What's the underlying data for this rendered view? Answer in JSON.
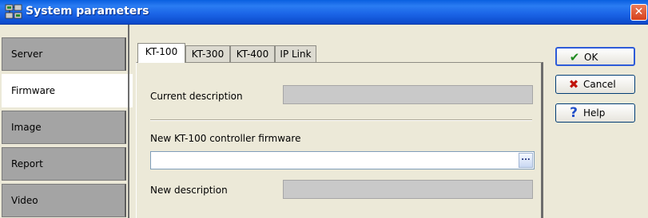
{
  "window": {
    "title": "System parameters",
    "close_symbol": "✕"
  },
  "nav": {
    "items": [
      {
        "label": "Server"
      },
      {
        "label": "Firmware"
      },
      {
        "label": "Image"
      },
      {
        "label": "Report"
      },
      {
        "label": "Video"
      }
    ],
    "active": "Firmware"
  },
  "tabs": {
    "items": [
      {
        "label": "KT-100"
      },
      {
        "label": "KT-300"
      },
      {
        "label": "KT-400"
      },
      {
        "label": "IP Link"
      }
    ],
    "active": "KT-100"
  },
  "firmware": {
    "current_description_label": "Current description",
    "current_description_value": "",
    "new_firmware_label": "New KT-100 controller firmware",
    "new_firmware_value": "",
    "browse_label": "...",
    "new_description_label": "New description",
    "new_description_value": ""
  },
  "buttons": {
    "ok": {
      "label": "OK",
      "icon": "check-icon",
      "icon_glyph": "✔",
      "icon_color": "#1e8a1e"
    },
    "cancel": {
      "label": "Cancel",
      "icon": "cross-icon",
      "icon_glyph": "✖",
      "icon_color": "#c0140c"
    },
    "help": {
      "label": "Help",
      "icon": "question-icon",
      "icon_glyph": "?",
      "icon_color": "#1f4fc9"
    }
  },
  "colors": {
    "titlebar": "#1a63e6",
    "nav_inactive": "#a4a4a4",
    "nav_active": "#ffffff",
    "field_readonly": "#c9c9c9"
  }
}
